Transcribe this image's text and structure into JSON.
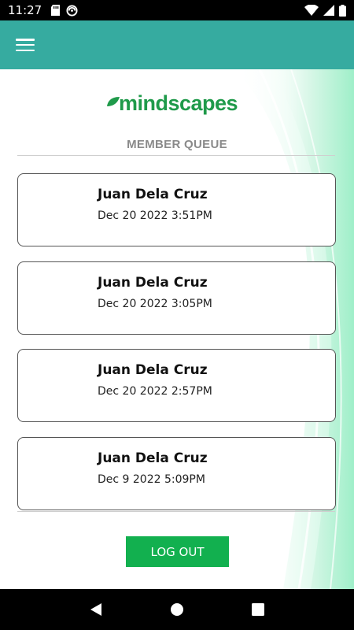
{
  "status_bar": {
    "time": "11:27",
    "icons": [
      "sd-card-icon",
      "sync-icon",
      "wifi-icon",
      "signal-icon",
      "battery-icon"
    ]
  },
  "app_bar": {
    "menu_icon": "hamburger-menu-icon",
    "color": "#36aba0"
  },
  "logo": {
    "text": "mindscapes",
    "color": "#1f9a4a"
  },
  "queue": {
    "title": "MEMBER QUEUE",
    "members": [
      {
        "name": "Juan Dela Cruz",
        "timestamp": "Dec 20 2022 3:51PM"
      },
      {
        "name": "Juan Dela Cruz",
        "timestamp": "Dec 20 2022 3:05PM"
      },
      {
        "name": "Juan Dela Cruz",
        "timestamp": "Dec 20 2022 2:57PM"
      },
      {
        "name": "Juan Dela Cruz",
        "timestamp": "Dec 9 2022 5:09PM"
      }
    ]
  },
  "actions": {
    "logout_label": "LOG OUT",
    "logout_color": "#12b04f"
  },
  "nav_bar": {
    "buttons": [
      "back-icon",
      "home-icon",
      "recents-icon"
    ]
  }
}
